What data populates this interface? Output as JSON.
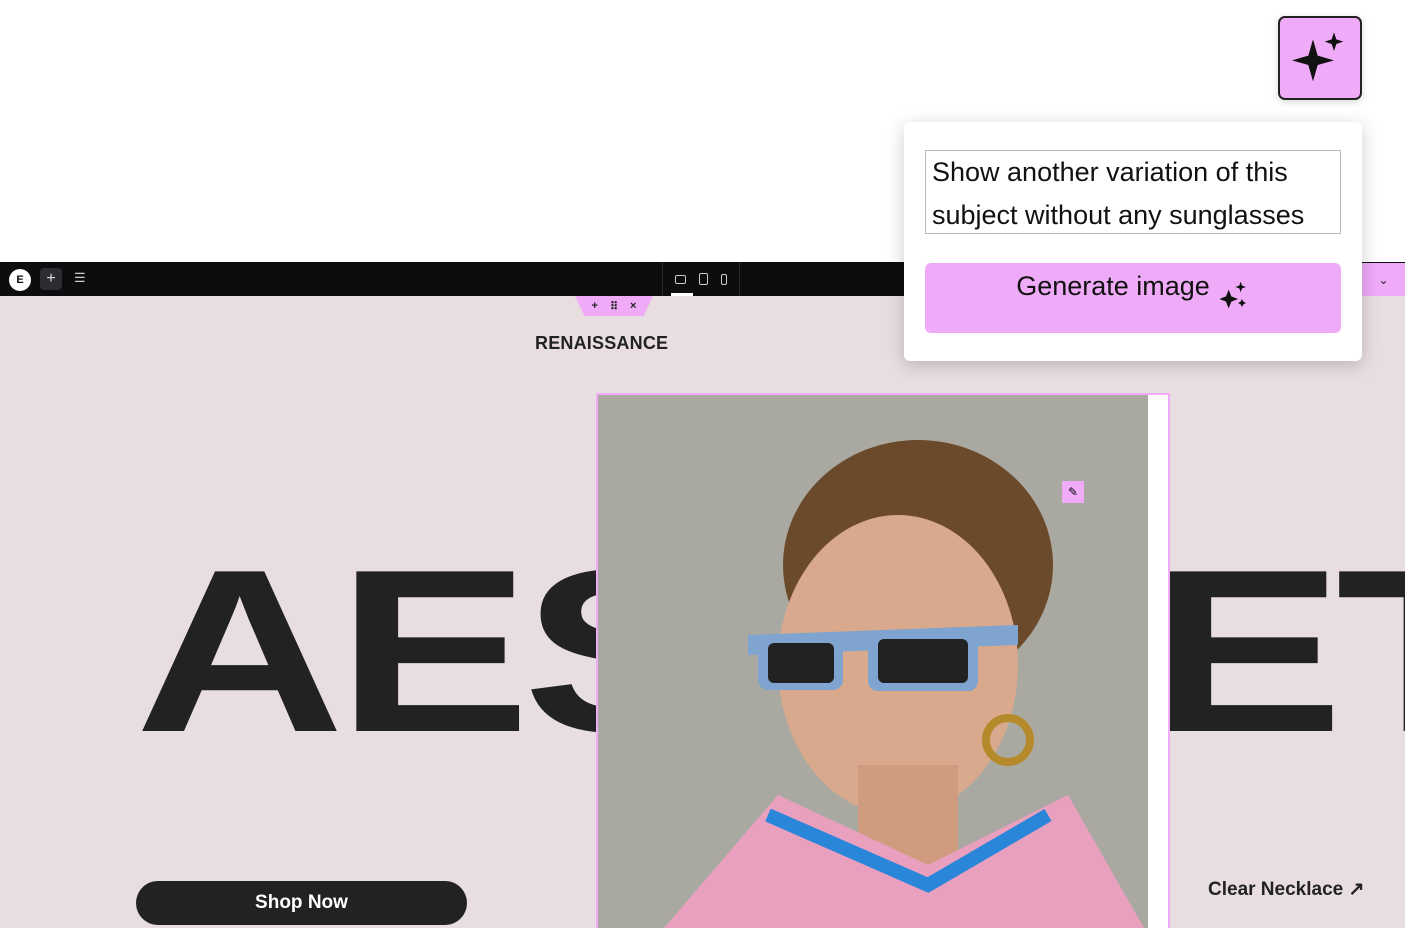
{
  "toolbar": {
    "logo_icon": "elementor-logo-icon",
    "add_icon": "plus-icon",
    "settings_icon": "sliders-icon",
    "devices": [
      "desktop",
      "tablet",
      "mobile"
    ],
    "chevron": "⌄"
  },
  "handle": {
    "add": "+",
    "drag": "⠿",
    "close": "×"
  },
  "page": {
    "brand": "RENAISSANCE",
    "headline_left": "AES",
    "headline_right": "ETI",
    "shop_button": "Shop Now",
    "link": "Clear Necklace",
    "link_arrow": "↗"
  },
  "ai": {
    "prompt": "Show another variation of this subject without any sunglasses",
    "generate_label": "Generate image"
  },
  "colors": {
    "accent": "#efabf8",
    "dark": "#222222",
    "canvas": "#e8dee2",
    "toolbar": "#0c0d0e"
  }
}
